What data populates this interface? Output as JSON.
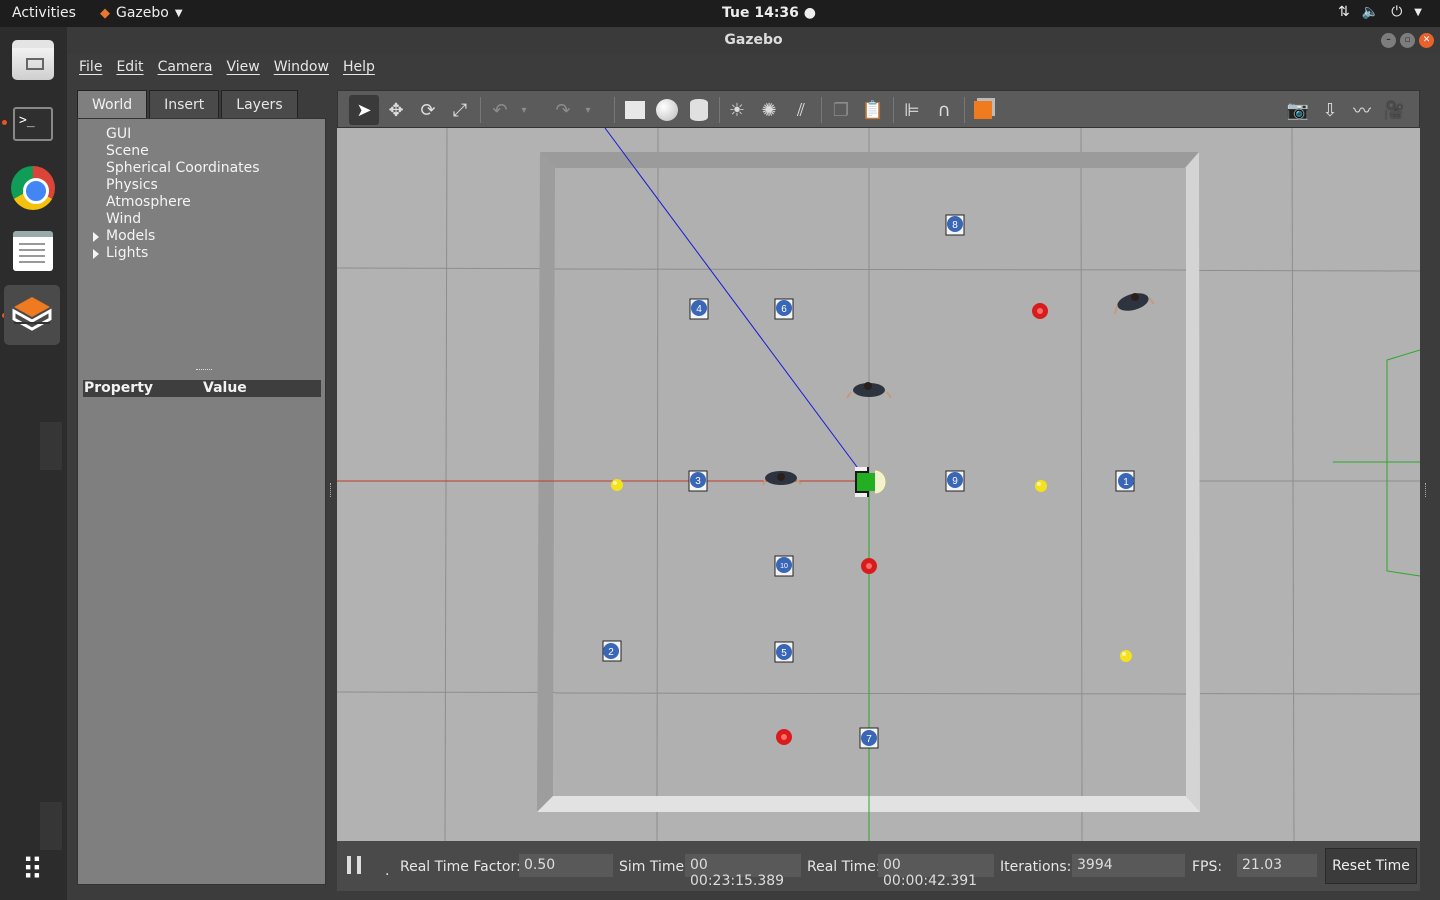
{
  "topbar": {
    "activities": "Activities",
    "app_name": "Gazebo",
    "clock": "Tue 14:36",
    "tray_icons": [
      "network-icon",
      "volume-icon",
      "power-icon",
      "menu-arrow-icon"
    ]
  },
  "dock": {
    "apps": [
      "files",
      "terminal",
      "chrome",
      "text-editor",
      "gazebo"
    ],
    "grid_label": "Show Applications"
  },
  "window": {
    "title": "Gazebo",
    "menus": [
      "File",
      "Edit",
      "Camera",
      "View",
      "Window",
      "Help"
    ]
  },
  "left_panel": {
    "tabs": [
      "World",
      "Insert",
      "Layers"
    ],
    "active_tab": "World",
    "tree": [
      "GUI",
      "Scene",
      "Spherical Coordinates",
      "Physics",
      "Atmosphere",
      "Wind",
      "Models",
      "Lights"
    ],
    "expandable": [
      "Models",
      "Lights"
    ],
    "property_header": "Property",
    "value_header": "Value"
  },
  "toolbar": {
    "tools": [
      "select-mode",
      "translate-mode",
      "rotate-mode",
      "scale-mode",
      "undo",
      "undo-dropdown",
      "redo",
      "redo-dropdown",
      "box-shape",
      "sphere-shape",
      "cylinder-shape",
      "point-light",
      "spot-light",
      "directional-light",
      "copy",
      "paste",
      "align",
      "snap",
      "change-view",
      "screenshot",
      "log",
      "plot",
      "record-video"
    ]
  },
  "scene": {
    "markers": [
      {
        "label": "1"
      },
      {
        "label": "2"
      },
      {
        "label": "3"
      },
      {
        "label": "4"
      },
      {
        "label": "5"
      },
      {
        "label": "6"
      },
      {
        "label": "7"
      },
      {
        "label": "8"
      },
      {
        "label": "9"
      },
      {
        "label": "10"
      }
    ],
    "colors": {
      "ground": "#b2b2b2",
      "wall": "#cdcdcd",
      "red_ball": "#d81c1c",
      "yellow_ball": "#f5e21a",
      "marker_blue": "#3a66b8",
      "laser_line": "#1a1ad6",
      "x_axis": "#c03a2a",
      "y_axis": "#2aa82a",
      "robot_green": "#22b022"
    }
  },
  "status": {
    "real_time_factor_label": "Real Time Factor:",
    "real_time_factor": "0.50",
    "sim_time_label": "Sim Time:",
    "sim_time": "00 00:23:15.389",
    "real_time_label": "Real Time:",
    "real_time": "00 00:00:42.391",
    "iterations_label": "Iterations:",
    "iterations": "3994",
    "fps_label": "FPS:",
    "fps": "21.03",
    "reset_label": "Reset Time"
  }
}
